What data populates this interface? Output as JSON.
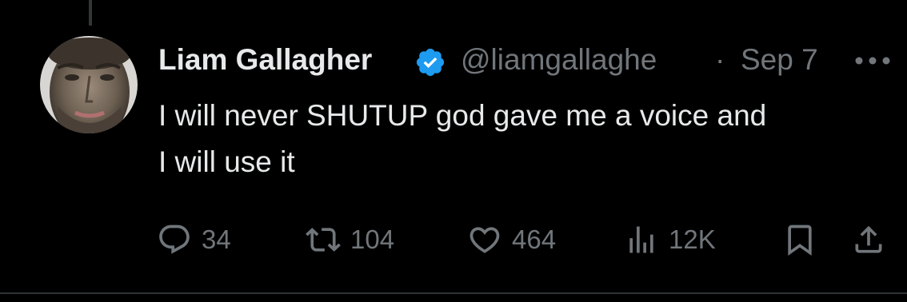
{
  "tweet": {
    "display_name": "Liam Gallagher",
    "handle": "@liamgallaghe",
    "separator": "·",
    "timestamp": "Sep 7",
    "text_line_1": "I will never SHUTUP god gave me a voice and",
    "text_line_2": "I will use it"
  },
  "actions": {
    "reply_count": "34",
    "repost_count": "104",
    "like_count": "464",
    "view_count": "12K"
  },
  "icons": {
    "avatar": "avatar-photo",
    "verified": "verified-badge-icon",
    "more": "more-options-icon",
    "reply": "reply-icon",
    "repost": "repost-icon",
    "like": "heart-icon",
    "views": "views-icon",
    "bookmark": "bookmark-icon",
    "share": "share-icon"
  },
  "colors": {
    "background": "#000000",
    "primary_text": "#e7e9ea",
    "secondary_text": "#71767b",
    "verified_blue": "#1d9bf0",
    "divider": "#2f3336"
  }
}
